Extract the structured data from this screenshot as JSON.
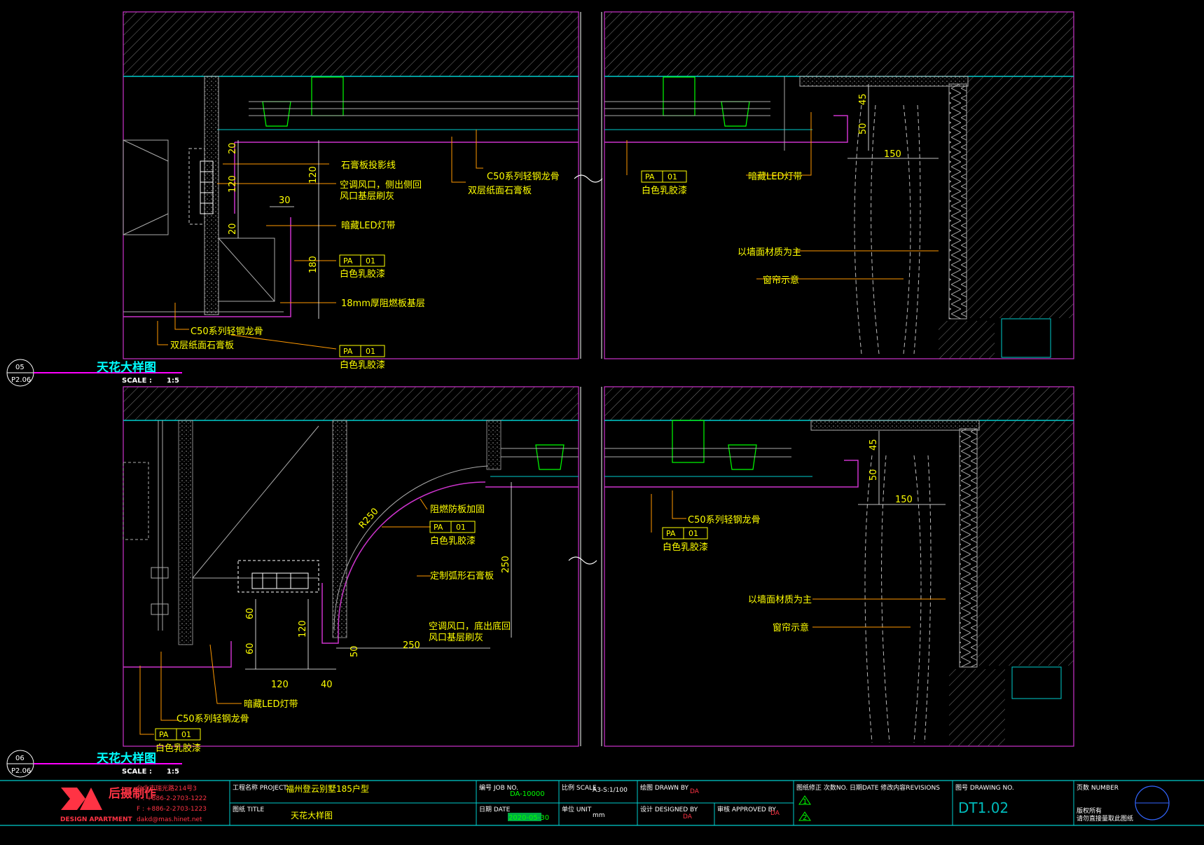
{
  "details": [
    {
      "title": "天花大样图",
      "scale_label": "SCALE :",
      "scale_value": "1:5",
      "bubble_number": "05",
      "bubble_sheet": "P2.06",
      "left_labels": {
        "gypsum_shadow_line": "石膏板投影线",
        "ac_vent_1": "空调风口，侧出侧回",
        "ac_vent_2": "风口基层刷灰",
        "led_strip": "暗藏LED灯带",
        "pa_code": "PA",
        "pa_num": "01",
        "latex_paint": "白色乳胶漆",
        "fireproof_board": "18mm厚阻燃板基层",
        "keel": "C50系列轻钢龙骨",
        "double_gypsum": "双层纸面石膏板",
        "pa2_code": "PA",
        "pa2_num": "01",
        "latex_paint_2": "白色乳胶漆"
      },
      "mid_labels": {
        "keel": "C50系列轻钢龙骨",
        "double_gypsum": "双层纸面石膏板",
        "pa_code": "PA",
        "pa_num": "01",
        "latex_paint": "白色乳胶漆"
      },
      "right_labels": {
        "led_strip": "暗藏LED灯带",
        "wall_material": "以墙面材质为主",
        "curtain": "窗帘示意"
      },
      "dimensions": {
        "d20a": "20",
        "d120a": "120",
        "d20b": "20",
        "d120b": "120",
        "d30": "30",
        "d180": "180",
        "d45": "45",
        "d50": "50",
        "d150": "150"
      }
    },
    {
      "title": "天花大样图",
      "scale_label": "SCALE :",
      "scale_value": "1:5",
      "bubble_number": "06",
      "bubble_sheet": "P2.06",
      "left_labels": {
        "radius": "R250",
        "fire_board": "阻燃防板加固",
        "pa_code": "PA",
        "pa_num": "01",
        "latex_paint": "白色乳胶漆",
        "curved_gypsum": "定制弧形石膏板",
        "ac_vent_1": "空调风口，底出底回",
        "ac_vent_2": "风口基层刷灰",
        "led_strip": "暗藏LED灯带",
        "keel": "C50系列轻钢龙骨",
        "pa2_code": "PA",
        "pa2_num": "01",
        "latex_paint_2": "白色乳胶漆"
      },
      "mid_labels": {
        "keel": "C50系列轻钢龙骨",
        "pa_code": "PA",
        "pa_num": "01",
        "latex_paint": "白色乳胶漆"
      },
      "right_labels": {
        "wall_material": "以墙面材质为主",
        "curtain": "窗帘示意"
      },
      "dimensions": {
        "d250v": "250",
        "d60a": "60",
        "d120": "120",
        "d60b": "60",
        "d50": "50",
        "d250h": "250",
        "d120h": "120",
        "d40": "40",
        "d45": "45",
        "d50r": "50",
        "d150": "150"
      }
    }
  ],
  "title_block": {
    "company_cn": "后摄制作",
    "company_en": "DESIGN APARTMENT",
    "address": "台北市瑞光路214号3",
    "tel": "T : +886-2-2703-1222",
    "fax": "F : +886-2-2703-1223",
    "email": "dakd@mas.hinet.net",
    "project_label": "工程名称 PROJECT",
    "project_value": "福州登云别墅185户型",
    "title_label": "图纸 TITLE",
    "title_value": "天花大样图",
    "job_label": "编号 JOB NO.",
    "job_value": "DA-10000",
    "date_label": "日期 DATE",
    "date_value": "2020-05-30",
    "scale_label": "比例 SCALE",
    "scale_value": "A3-S:1/100",
    "unit_label": "单位 UNIT",
    "unit_value": "mm",
    "drawn_label": "绘图 DRAWN BY",
    "drawn_value": "DA",
    "designed_label": "设计 DESIGNED BY",
    "designed_value": "DA",
    "approved_label": "审核 APPROVED BY",
    "approved_value": "DA",
    "revisions_label": "图纸修正 次数NO. 日期DATE 修改内容REVISIONS",
    "rev1": "1",
    "rev2": "2",
    "drawing_no_label": "图号 DRAWING NO.",
    "drawing_no_value": "DT1.02",
    "page_label": "页数 NUMBER",
    "copyright_1": "版权所有",
    "copyright_2": "请勿直接量取此图纸"
  },
  "colors": {
    "background": "#000000",
    "frame": "#cc33cc",
    "cyan": "#00ffff",
    "yellow": "#ffff00",
    "green": "#00ff00",
    "orange": "#ff9900",
    "red": "#ff3344",
    "white": "#ffffff"
  }
}
